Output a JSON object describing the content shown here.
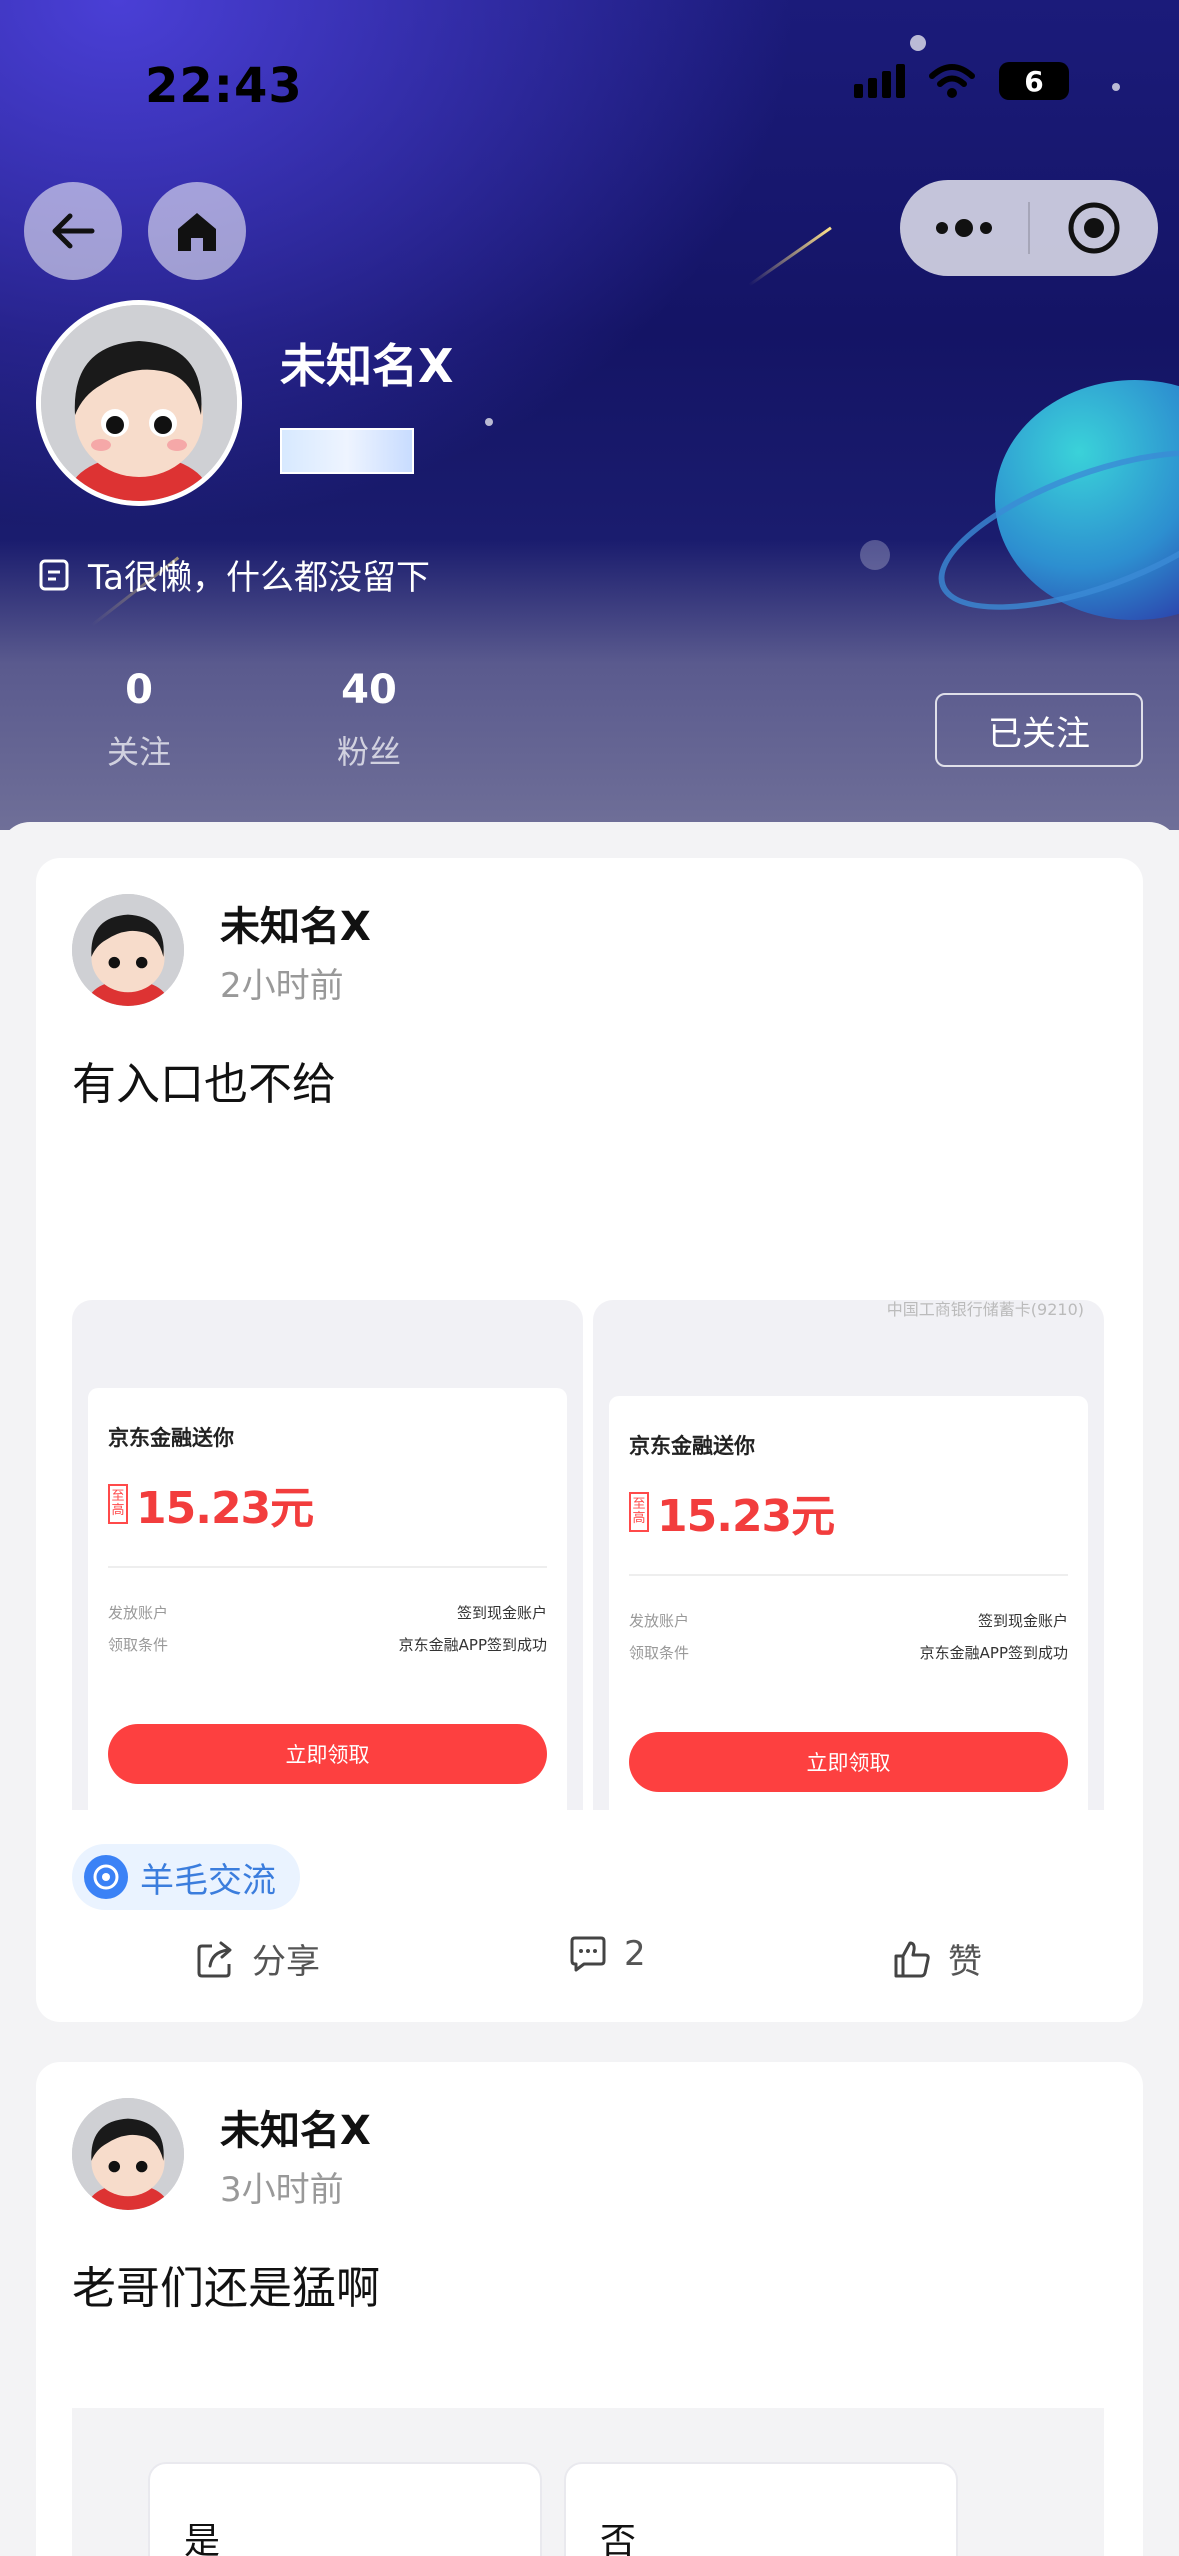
{
  "status_bar": {
    "time": "22:43",
    "battery": "6"
  },
  "profile": {
    "name": "未知名X",
    "bio": "Ta很懒，什么都没留下",
    "stats": [
      {
        "value": "0",
        "label": "关注"
      },
      {
        "value": "40",
        "label": "粉丝"
      }
    ],
    "follow_label": "已关注"
  },
  "posts": [
    {
      "author": "未知名X",
      "time": "2小时前",
      "text": "有入口也不给",
      "images": [
        {
          "title": "京东金融送你",
          "tag": "至高",
          "amount": "15.23元",
          "row1_label": "发放账户",
          "row1_value": "签到现金账户",
          "row2_label": "领取条件",
          "row2_value": "京东金融APP签到成功",
          "button": "立即领取"
        },
        {
          "title": "京东金融送你",
          "tag": "至高",
          "amount": "15.23元",
          "row1_label": "发放账户",
          "row1_value": "签到现金账户",
          "row2_label": "领取条件",
          "row2_value": "京东金融APP签到成功",
          "button": "立即领取",
          "top_fragment": "中国工商银行储蓄卡(9210)"
        }
      ],
      "topic": "羊毛交流",
      "actions": {
        "share": "分享",
        "comments": "2",
        "like": "赞"
      }
    },
    {
      "author": "未知名X",
      "time": "3小时前",
      "text": "老哥们还是猛啊",
      "poll_options": [
        "是",
        "否"
      ]
    }
  ],
  "colors": {
    "accent_red": "#f23d3d",
    "topic_blue": "#3b7ddd",
    "cover_deep": "#141465"
  }
}
